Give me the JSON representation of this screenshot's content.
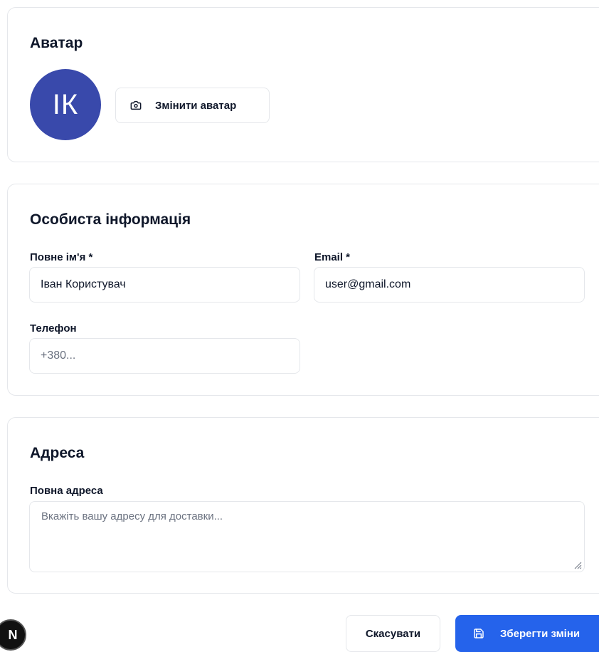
{
  "avatar_section": {
    "title": "Аватар",
    "initials": "ІК",
    "change_button": "Змінити аватар"
  },
  "personal_section": {
    "title": "Особиста інформація",
    "full_name": {
      "label": "Повне ім'я *",
      "value": "Іван Користувач"
    },
    "email": {
      "label": "Email *",
      "value": "user@gmail.com"
    },
    "phone": {
      "label": "Телефон",
      "value": "",
      "placeholder": "+380..."
    }
  },
  "address_section": {
    "title": "Адреса",
    "full_address": {
      "label": "Повна адреса",
      "value": "",
      "placeholder": "Вкажіть вашу адресу для доставки..."
    }
  },
  "actions": {
    "cancel": "Скасувати",
    "save": "Зберегти зміни"
  },
  "badge": {
    "letter": "N"
  },
  "colors": {
    "avatar_bg": "#3949ab",
    "primary": "#2563eb",
    "border": "#e5e7eb"
  },
  "icons": {
    "change_avatar": "camera-icon",
    "save": "floppy-disk-icon"
  }
}
